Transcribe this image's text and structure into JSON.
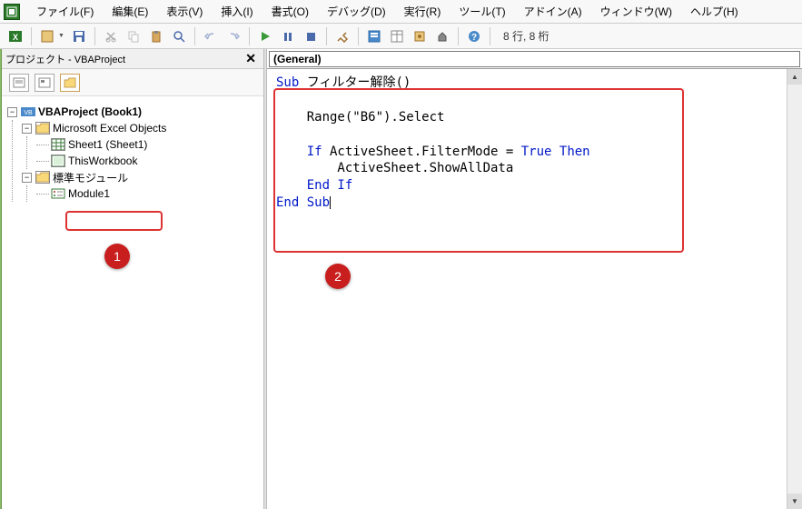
{
  "menu": {
    "file": "ファイル(F)",
    "edit": "編集(E)",
    "view": "表示(V)",
    "insert": "挿入(I)",
    "format": "書式(O)",
    "debug": "デバッグ(D)",
    "run": "実行(R)",
    "tools": "ツール(T)",
    "addins": "アドイン(A)",
    "window": "ウィンドウ(W)",
    "help": "ヘルプ(H)"
  },
  "status": {
    "pos": "8 行, 8 桁"
  },
  "project": {
    "panel_title": "プロジェクト - VBAProject",
    "root": "VBAProject (Book1)",
    "excel_objects": "Microsoft Excel Objects",
    "sheet1": "Sheet1 (Sheet1)",
    "this_workbook": "ThisWorkbook",
    "std_modules": "標準モジュール",
    "module1": "Module1"
  },
  "code": {
    "combo_left": "(General)",
    "lines": {
      "l1a": "Sub",
      "l1b": " フィルター解除()",
      "l2": "    Range(\"B6\").Select",
      "l3a": "    ",
      "l3b": "If",
      "l3c": " ActiveSheet.FilterMode = ",
      "l3d": "True",
      "l3e": " ",
      "l3f": "Then",
      "l4": "        ActiveSheet.ShowAllData",
      "l5a": "    ",
      "l5b": "End If",
      "l6": "End Sub"
    }
  },
  "callouts": {
    "one": "1",
    "two": "2"
  }
}
